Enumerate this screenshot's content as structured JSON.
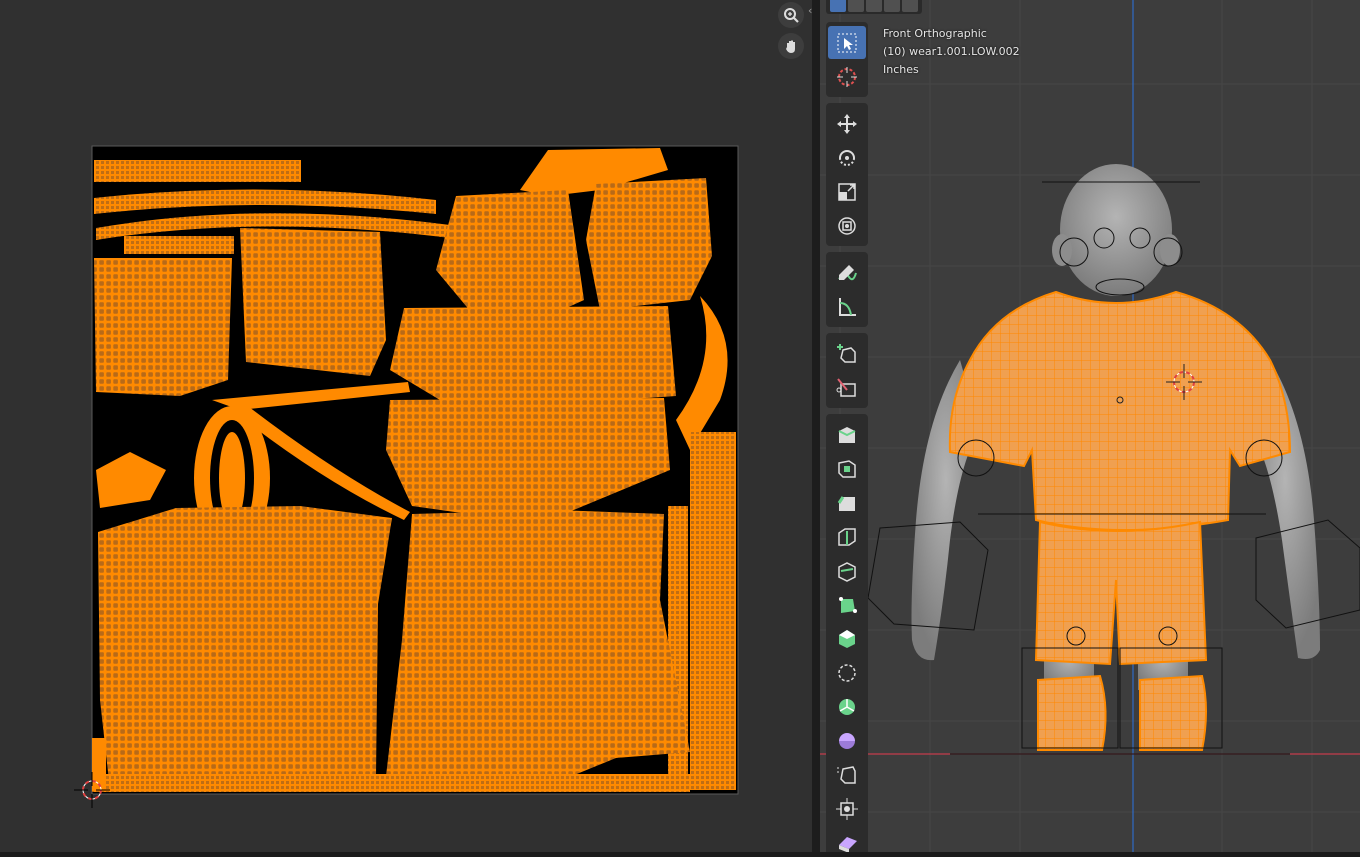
{
  "viewport": {
    "view_name": "Front Orthographic",
    "object_info": "(10) wear1.001.LOW.002",
    "units": "Inches"
  },
  "colors": {
    "uv_fill": "#ff8a00",
    "uv_bg": "#000000",
    "editor_bg": "#303030",
    "viewport_bg": "#3d3d3d",
    "active_tool": "#4772b3",
    "x_axis": "#c43c4c",
    "z_axis": "#2f6bc6"
  },
  "uv_nav": [
    {
      "name": "zoom",
      "icon": "zoom-icon"
    },
    {
      "name": "pan",
      "icon": "hand-icon"
    }
  ],
  "selection_modes": [
    "vertex",
    "edge",
    "face",
    "mode-4",
    "mode-5"
  ],
  "tools": [
    {
      "group": 1,
      "name": "select-box",
      "icon": "cursor-box-icon",
      "active": true
    },
    {
      "group": 1,
      "name": "cursor",
      "icon": "cursor-3d-icon"
    },
    {
      "group": 2,
      "name": "move",
      "icon": "move-icon"
    },
    {
      "group": 2,
      "name": "rotate",
      "icon": "rotate-icon"
    },
    {
      "group": 2,
      "name": "scale",
      "icon": "scale-icon"
    },
    {
      "group": 2,
      "name": "transform",
      "icon": "transform-icon"
    },
    {
      "group": 3,
      "name": "annotate",
      "icon": "annotate-icon"
    },
    {
      "group": 3,
      "name": "measure",
      "icon": "measure-icon"
    },
    {
      "group": 4,
      "name": "add-cube",
      "icon": "add-cube-icon"
    },
    {
      "group": 4,
      "name": "knife-project",
      "icon": "knife-icon"
    },
    {
      "group": 5,
      "name": "extrude",
      "icon": "extrude-icon"
    },
    {
      "group": 5,
      "name": "inset",
      "icon": "inset-icon"
    },
    {
      "group": 5,
      "name": "bevel",
      "icon": "bevel-icon"
    },
    {
      "group": 5,
      "name": "loop-cut",
      "icon": "loop-cut-icon"
    },
    {
      "group": 5,
      "name": "knife",
      "icon": "knife-cut-icon"
    },
    {
      "group": 5,
      "name": "poly-build",
      "icon": "poly-build-icon"
    },
    {
      "group": 5,
      "name": "spin",
      "icon": "spin-icon"
    },
    {
      "group": 5,
      "name": "smooth",
      "icon": "smooth-icon"
    },
    {
      "group": 5,
      "name": "edge-slide",
      "icon": "edge-slide-icon"
    },
    {
      "group": 5,
      "name": "shrink-fatten",
      "icon": "shrink-icon"
    },
    {
      "group": 5,
      "name": "shear",
      "icon": "shear-icon"
    },
    {
      "group": 5,
      "name": "to-sphere",
      "icon": "sphere-icon"
    },
    {
      "group": 5,
      "name": "rip",
      "icon": "rip-icon"
    }
  ]
}
